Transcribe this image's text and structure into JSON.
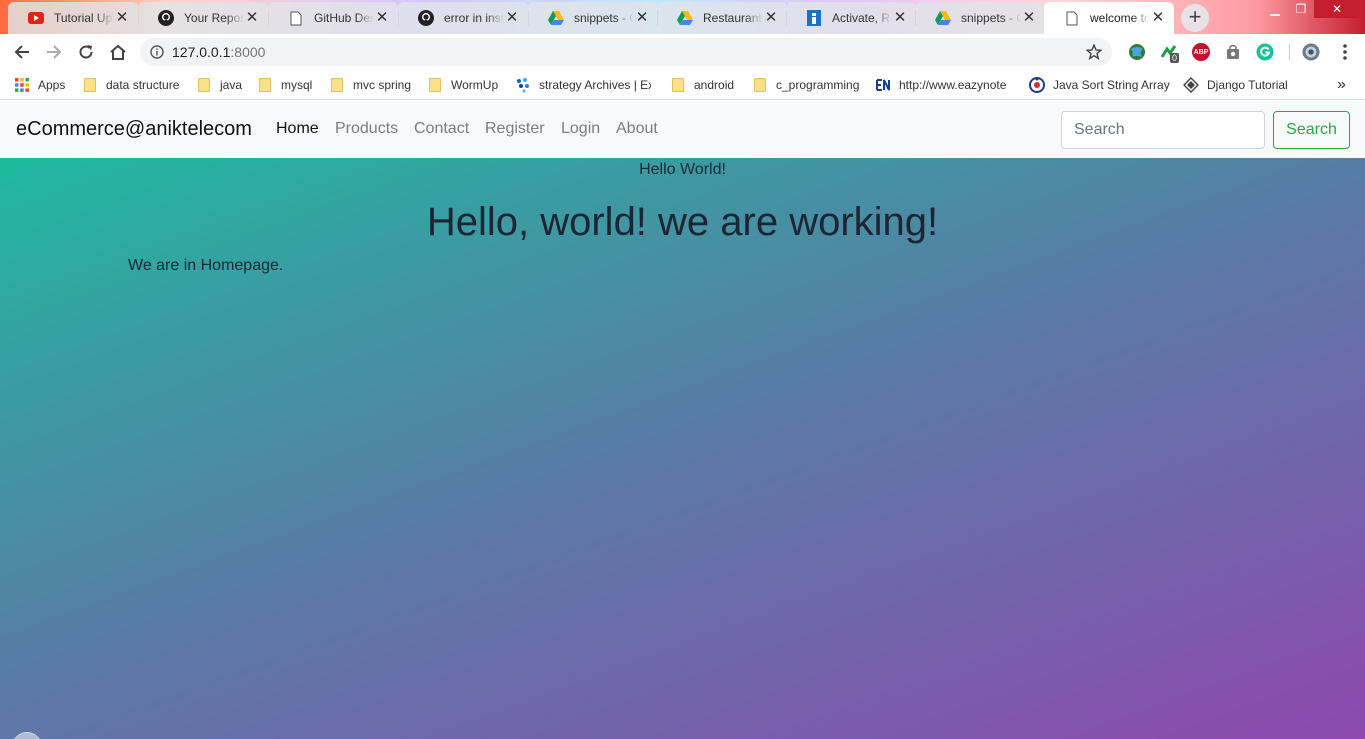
{
  "browser": {
    "tabs": [
      {
        "title": "Tutorial Upload",
        "icon": "youtube-icon"
      },
      {
        "title": "Your Repositories",
        "icon": "github-icon"
      },
      {
        "title": "GitHub Desktop",
        "icon": "page-icon"
      },
      {
        "title": "error in install",
        "icon": "github-icon"
      },
      {
        "title": "snippets - Google Drive",
        "icon": "google-drive-icon"
      },
      {
        "title": "Restaurant - Google Drive",
        "icon": "google-drive-icon"
      },
      {
        "title": "Activate, Restore",
        "icon": "app-icon"
      },
      {
        "title": "snippets - Google Drive",
        "icon": "google-drive-icon"
      },
      {
        "title": "welcome to",
        "icon": "page-icon",
        "active": true
      }
    ],
    "tab_close_glyph": "✕",
    "new_tab_glyph": "+",
    "window_controls": {
      "minimize": "▁",
      "restore": "❐",
      "close": "✕"
    },
    "address": {
      "host": "127.0.0.1",
      "port": ":8000"
    },
    "extension_badge": "0",
    "abp_label": "ABP",
    "bookmarks": [
      {
        "label": "Apps",
        "icon": "apps-grid-icon"
      },
      {
        "label": "data structure",
        "icon": "folder-icon"
      },
      {
        "label": "java",
        "icon": "folder-icon"
      },
      {
        "label": "mysql",
        "icon": "folder-icon"
      },
      {
        "label": "mvc spring",
        "icon": "folder-icon"
      },
      {
        "label": "WormUp",
        "icon": "folder-icon"
      },
      {
        "label": "strategy Archives | Ex",
        "icon": "site-icon"
      },
      {
        "label": "android",
        "icon": "folder-icon"
      },
      {
        "label": "c_programming",
        "icon": "folder-icon"
      },
      {
        "label": "http://www.eazynote",
        "icon": "site-icon"
      },
      {
        "label": "Java Sort String Array",
        "icon": "site-icon"
      },
      {
        "label": "Django Tutorial",
        "icon": "site-icon"
      }
    ],
    "bookmarks_overflow": "»"
  },
  "navbar": {
    "brand": "eCommerce@aniktelecom",
    "links": [
      {
        "label": "Home",
        "active": true
      },
      {
        "label": "Products"
      },
      {
        "label": "Contact"
      },
      {
        "label": "Register"
      },
      {
        "label": "Login"
      },
      {
        "label": "About"
      }
    ],
    "search": {
      "placeholder": "Search",
      "button_label": "Search"
    }
  },
  "content": {
    "small_heading": "Hello World!",
    "big_heading": "Hello, world! we are working!",
    "paragraph": "We are in Homepage."
  },
  "colors": {
    "success": "#28a745",
    "gradient_start": "#1fbaa0",
    "gradient_end": "#8e48ae"
  }
}
